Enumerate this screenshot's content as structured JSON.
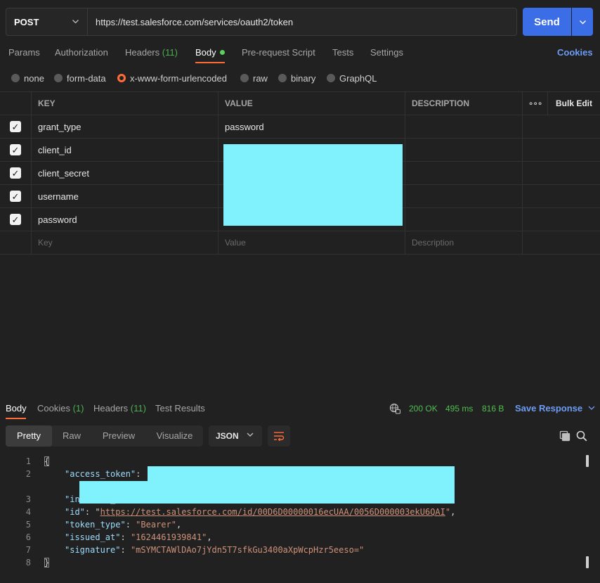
{
  "request": {
    "method": "POST",
    "url": "https://test.salesforce.com/services/oauth2/token",
    "send_label": "Send"
  },
  "tabs": {
    "params": "Params",
    "authorization": "Authorization",
    "headers": "Headers",
    "headers_count": "(11)",
    "body": "Body",
    "prerequest": "Pre-request Script",
    "tests": "Tests",
    "settings": "Settings",
    "cookies": "Cookies"
  },
  "body_types": {
    "none": "none",
    "form_data": "form-data",
    "urlencoded": "x-www-form-urlencoded",
    "raw": "raw",
    "binary": "binary",
    "graphql": "GraphQL",
    "selected": "x-www-form-urlencoded"
  },
  "table": {
    "headers": {
      "key": "KEY",
      "value": "VALUE",
      "description": "DESCRIPTION",
      "more": "∘∘∘",
      "bulk_edit": "Bulk Edit"
    },
    "rows": [
      {
        "key": "grant_type",
        "value": "password",
        "checked": true
      },
      {
        "key": "client_id",
        "value": "",
        "checked": true
      },
      {
        "key": "client_secret",
        "value": "",
        "checked": true
      },
      {
        "key": "username",
        "value": "",
        "checked": true
      },
      {
        "key": "password",
        "value": "",
        "checked": true
      }
    ],
    "placeholders": {
      "key": "Key",
      "value": "Value",
      "description": "Description"
    }
  },
  "response": {
    "tabs": {
      "body": "Body",
      "cookies": "Cookies",
      "cookies_count": "(1)",
      "headers": "Headers",
      "headers_count": "(11)",
      "test_results": "Test Results"
    },
    "status": "200 OK",
    "time": "495 ms",
    "size": "816 B",
    "save_label": "Save Response",
    "views": {
      "pretty": "Pretty",
      "raw": "Raw",
      "preview": "Preview",
      "visualize": "Visualize"
    },
    "format": "JSON",
    "line_numbers": [
      "1",
      "2",
      "3",
      "4",
      "5",
      "6",
      "7",
      "8"
    ],
    "json": {
      "open": "{",
      "close": "}",
      "access_token_key": "\"access_token\"",
      "instance_url_key": "\"instance_url\"",
      "id_key": "\"id\"",
      "id_value": "https://test.salesforce.com/id/00D6D00000016ecUAA/0056D000003ekU6QAI",
      "token_type_key": "\"token_type\"",
      "token_type_value": "\"Bearer\"",
      "issued_at_key": "\"issued_at\"",
      "issued_at_value": "\"1624461939841\"",
      "signature_key": "\"signature\"",
      "signature_value": "\"mSYMCTAWlDAo7jYdn5T7sfkGu3400aXpWcpHzr5eeso=\""
    }
  },
  "colors": {
    "accent_orange": "#ff6c37",
    "send_blue": "#3b6de6",
    "link_blue": "#6d9cf4",
    "status_green": "#4fbf4f",
    "redaction_cyan": "#80f2fe"
  }
}
